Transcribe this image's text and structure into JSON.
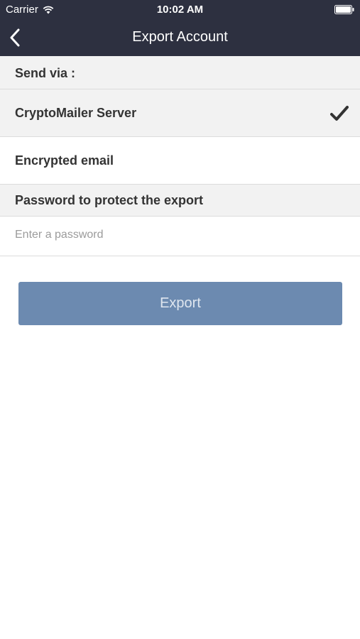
{
  "status_bar": {
    "carrier": "Carrier",
    "time": "10:02 AM"
  },
  "nav": {
    "title": "Export Account",
    "back_icon": "chevron-left-icon"
  },
  "send_via": {
    "header": "Send via :",
    "options": [
      {
        "label": "CryptoMailer Server",
        "selected": true
      },
      {
        "label": "Encrypted email",
        "selected": false
      }
    ]
  },
  "password": {
    "header": "Password to protect the export",
    "placeholder": "Enter a password",
    "value": ""
  },
  "export_button": {
    "label": "Export"
  },
  "colors": {
    "navbar_bg": "#2d3040",
    "section_bg": "#f2f2f2",
    "button_bg": "#6c8ab0",
    "checkmark": "#333333"
  }
}
